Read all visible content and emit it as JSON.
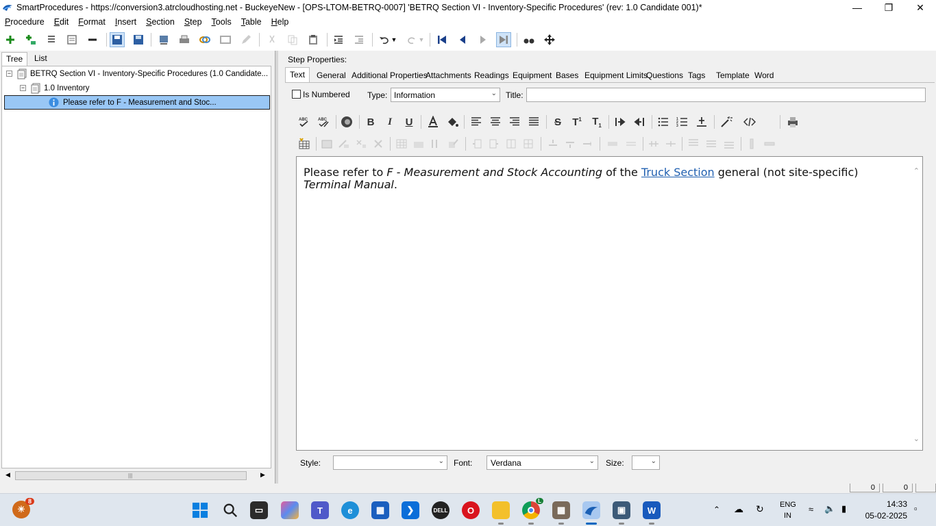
{
  "window": {
    "title": "SmartProcedures - https://conversion3.atrcloudhosting.net - BuckeyeNew - [OPS-LTOM-BETRQ-0007] 'BETRQ  Section VI - Inventory-Specific Procedures' (rev: 1.0 Candidate 001)*"
  },
  "menu": [
    "Procedure",
    "Edit",
    "Format",
    "Insert",
    "Section",
    "Step",
    "Tools",
    "Table",
    "Help"
  ],
  "left": {
    "tabs": [
      "Tree",
      "List"
    ],
    "tree": {
      "root": "BETRQ  Section VI - Inventory-Specific Procedures (1.0 Candidate...",
      "child": "1.0 Inventory",
      "step": "Please refer to F - Measurement and Stoc..."
    }
  },
  "right": {
    "label": "Step Properties:",
    "tabs": [
      "Text",
      "General",
      "Additional Properties",
      "Attachments",
      "Readings",
      "Equipment",
      "Bases",
      "Equipment Limits",
      "Questions",
      "Tags",
      "Template",
      "Word"
    ],
    "is_numbered_label": "Is Numbered",
    "type_label": "Type:",
    "type_value": "Information",
    "title_label": "Title:",
    "title_value": "",
    "editor": {
      "p1": "Please refer to ",
      "p2": "F - Measurement and Stock Accounting",
      "p3": " of the ",
      "link": "Truck Section",
      "p4": " general (not site-specific) ",
      "p5": "Terminal Manual",
      "p6": "."
    },
    "style_label": "Style:",
    "style_value": "",
    "font_label": "Font:",
    "font_value": "Verdana",
    "size_label": "Size:",
    "size_value": ""
  },
  "statusbar": {
    "box1": "0",
    "box2": "0"
  },
  "taskbar": {
    "widget_badge": "8",
    "lang1": "ENG",
    "lang2": "IN",
    "time": "14:33",
    "date": "05-02-2025",
    "chrome_badge": "L"
  }
}
